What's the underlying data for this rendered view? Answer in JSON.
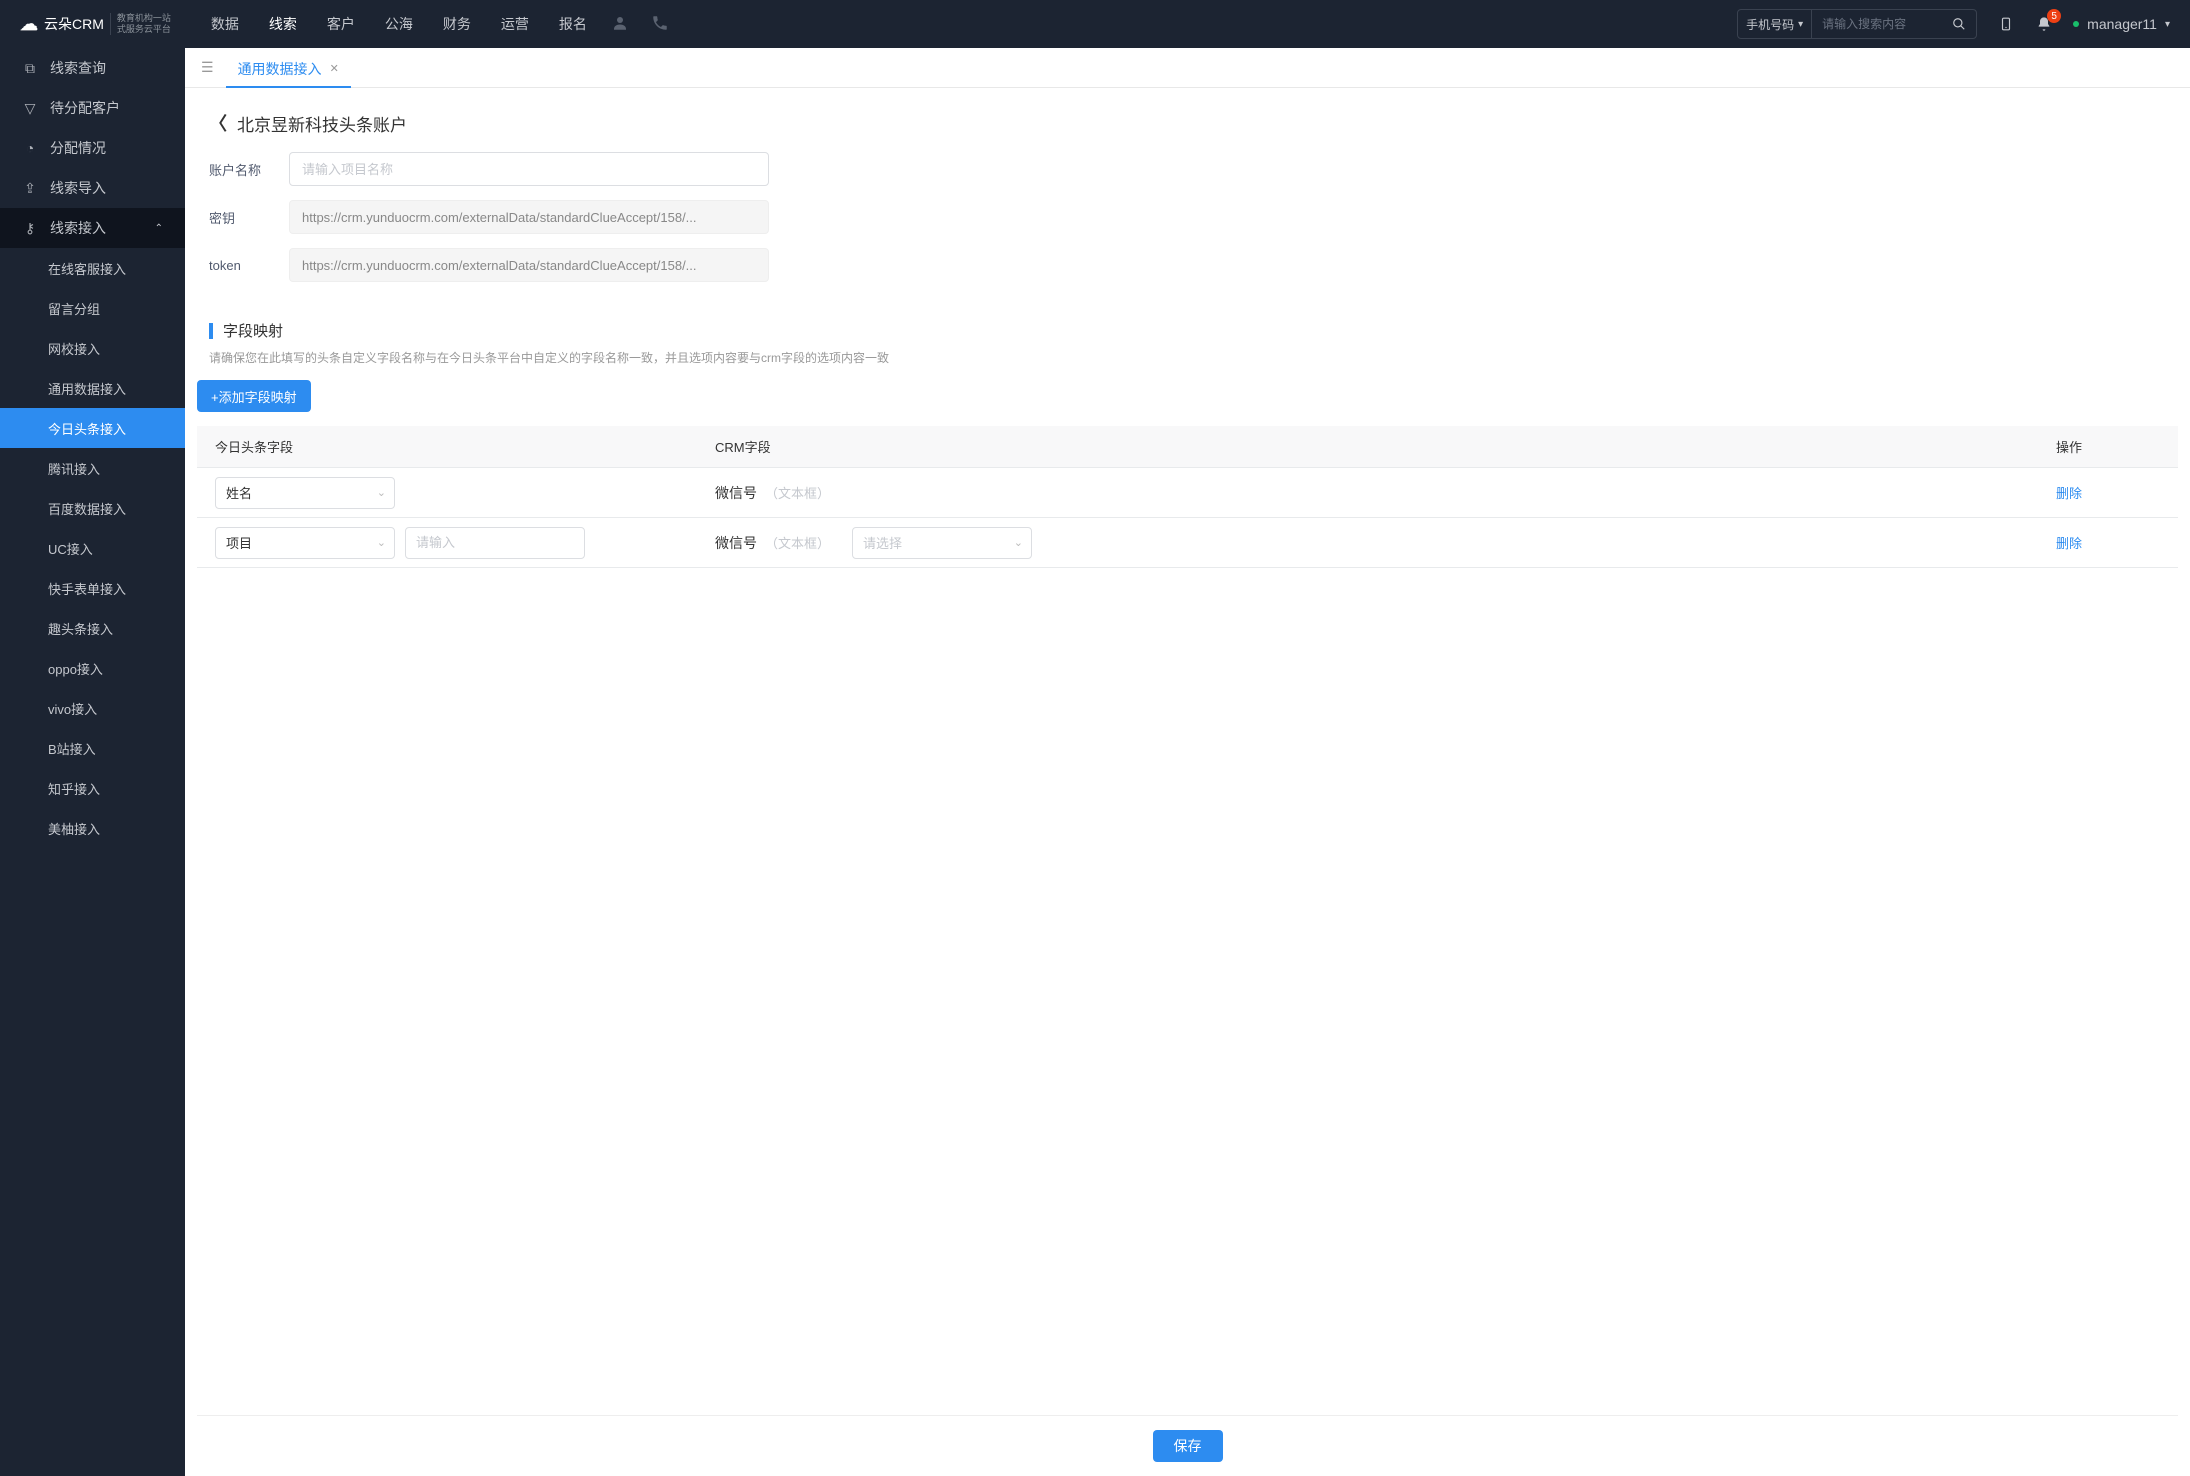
{
  "logo": {
    "brand": "云朵CRM",
    "sub1": "教育机构一站",
    "sub2": "式服务云平台",
    "url": "www.yunduocrm.com"
  },
  "nav": {
    "items": [
      "数据",
      "线索",
      "客户",
      "公海",
      "财务",
      "运营",
      "报名"
    ],
    "active": 1
  },
  "search": {
    "type": "手机号码",
    "placeholder": "请输入搜索内容"
  },
  "notif_count": "5",
  "user": "manager11",
  "sidebar": {
    "items": [
      {
        "label": "线索查询"
      },
      {
        "label": "待分配客户"
      },
      {
        "label": "分配情况"
      },
      {
        "label": "线索导入"
      },
      {
        "label": "线索接入",
        "expanded": true,
        "children": [
          {
            "label": "在线客服接入"
          },
          {
            "label": "留言分组"
          },
          {
            "label": "网校接入"
          },
          {
            "label": "通用数据接入"
          },
          {
            "label": "今日头条接入",
            "active": true
          },
          {
            "label": "腾讯接入"
          },
          {
            "label": "百度数据接入"
          },
          {
            "label": "UC接入"
          },
          {
            "label": "快手表单接入"
          },
          {
            "label": "趣头条接入"
          },
          {
            "label": "oppo接入"
          },
          {
            "label": "vivo接入"
          },
          {
            "label": "B站接入"
          },
          {
            "label": "知乎接入"
          },
          {
            "label": "美柚接入"
          }
        ]
      }
    ]
  },
  "tabs": {
    "active": "通用数据接入"
  },
  "page": {
    "title": "北京昱新科技头条账户",
    "form": {
      "name_label": "账户名称",
      "name_ph": "请输入项目名称",
      "key_label": "密钥",
      "key_val": "https://crm.yunduocrm.com/externalData/standardClueAccept/158/...",
      "token_label": "token",
      "token_val": "https://crm.yunduocrm.com/externalData/standardClueAccept/158/..."
    },
    "section": {
      "title": "字段映射",
      "help": "请确保您在此填写的头条自定义字段名称与在今日头条平台中自定义的字段名称一致，并且选项内容要与crm字段的选项内容一致",
      "add": "+添加字段映射"
    },
    "table": {
      "h1": "今日头条字段",
      "h2": "CRM字段",
      "h3": "操作",
      "rows": [
        {
          "field": "姓名",
          "crm": "微信号",
          "crm_type": "（文本框）"
        },
        {
          "field": "项目",
          "input_ph": "请输入",
          "crm": "微信号",
          "crm_type": "（文本框）",
          "select_ph": "请选择"
        }
      ],
      "del": "删除"
    },
    "save": "保存"
  }
}
